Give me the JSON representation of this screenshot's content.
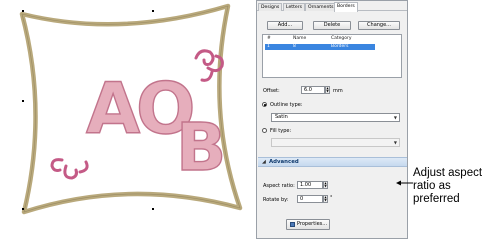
{
  "design": {
    "letters": "AOB",
    "frame_color": "#b9a97c",
    "letter_color": "#e6aebc",
    "letter_outline": "#c2748c",
    "ornament_color": "#c45a86"
  },
  "panel": {
    "tabs": [
      {
        "label": "Designs"
      },
      {
        "label": "Letters"
      },
      {
        "label": "Ornaments"
      },
      {
        "label": "Borders",
        "active": true
      }
    ],
    "buttons": {
      "add": "Add...",
      "delete": "Delete",
      "change": "Change..."
    },
    "list": {
      "columns": [
        "#",
        "Name",
        "Category"
      ],
      "rows": [
        {
          "index": "1",
          "name": "8",
          "category": "Borders"
        }
      ]
    },
    "offset": {
      "label": "Offset:",
      "value": "6.0",
      "unit": "mm"
    },
    "outline_type": {
      "label": "Outline type:",
      "selected": true,
      "value": "Satin"
    },
    "fill_type": {
      "label": "Fill type:",
      "selected": false,
      "value": ""
    },
    "advanced": {
      "title": "Advanced"
    },
    "aspect_ratio": {
      "label": "Aspect ratio:",
      "value": "1.00"
    },
    "rotate_by": {
      "label": "Rotate by:",
      "value": "0",
      "unit": "°"
    },
    "properties_button": "Properties..."
  },
  "annotation": {
    "text": "Adjust aspect ratio as preferred"
  }
}
